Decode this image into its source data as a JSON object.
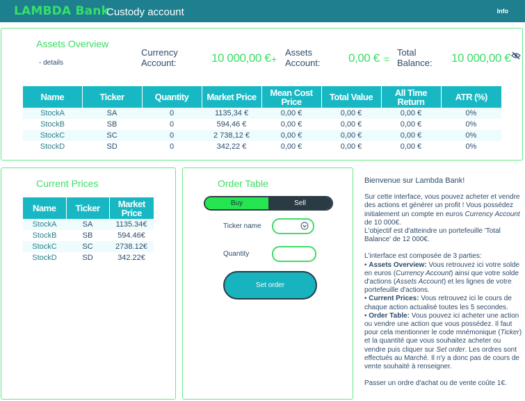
{
  "header": {
    "brand": "LAMBDA Bank",
    "subtitle": "Custody account",
    "info_label": "Info"
  },
  "assets": {
    "title": "Assets Overview",
    "details_label": "- details",
    "currency_label_1": "Currency",
    "currency_label_2": "Account:",
    "currency_value": "10 000,00 €",
    "plus": "+",
    "assets_label_1": "Assets",
    "assets_label_2": "Account:",
    "assets_value": "0,00 €",
    "equals": "=",
    "total_label_1": "Total",
    "total_label_2": "Balance:",
    "total_value": "10 000,00 €",
    "hide_icon": "eye-slash-icon",
    "columns": [
      "Name",
      "Ticker",
      "Quantity",
      "Market Price",
      "Mean Cost Price",
      "Total Value",
      "All Time Return",
      "ATR (%)"
    ],
    "rows": [
      [
        "StockA",
        "SA",
        "0",
        "1135,34 €",
        "0,00 €",
        "0,00 €",
        "0,00 €",
        "0%"
      ],
      [
        "StockB",
        "SB",
        "0",
        "594,46 €",
        "0,00 €",
        "0,00 €",
        "0,00 €",
        "0%"
      ],
      [
        "StockC",
        "SC",
        "0",
        "2 738,12 €",
        "0,00 €",
        "0,00 €",
        "0,00 €",
        "0%"
      ],
      [
        "StockD",
        "SD",
        "0",
        "342,22 €",
        "0,00 €",
        "0,00 €",
        "0,00 €",
        "0%"
      ]
    ]
  },
  "prices": {
    "title": "Current Prices",
    "columns": [
      "Name",
      "Ticker",
      "Market Price"
    ],
    "rows": [
      [
        "StockA",
        "SA",
        "1135.34€"
      ],
      [
        "StockB",
        "SB",
        "594.46€"
      ],
      [
        "StockC",
        "SC",
        "2738.12€"
      ],
      [
        "StockD",
        "SD",
        "342.22€"
      ]
    ]
  },
  "order": {
    "title": "Order Table",
    "buy_label": "Buy",
    "sell_label": "Sell",
    "ticker_label": "Ticker name",
    "ticker_value": "",
    "quantity_label": "Quantity",
    "quantity_value": "",
    "submit_label": "Set order"
  },
  "help": {
    "welcome": "Bienvenue sur Lambda Bank!",
    "p1_a": "Sur cette interface, vous pouvez acheter et vendre des actions et générer un profit ! Vous possédez initialement un compte en euros ",
    "p1_em": "Currency Account",
    "p1_b": " de 10 000€.",
    "p1_c": "L'objectif est d'atteindre un portefeuille 'Total Balance' de 12 000€.",
    "p2_intro": "L'interface est composée de 3 parties:",
    "b1_title": "Assets Overview:",
    "b1_a": " Vous retrouvez ici votre solde en euros (",
    "b1_em1": "Currency Account",
    "b1_b": ") ainsi que votre solde d'actions (",
    "b1_em2": "Assets Account",
    "b1_c": ") et les lignes de votre portefeuille d'actions.",
    "b2_title": "Current Prices:",
    "b2_a": " Vous retrouvez ici le cours de chaque action actualisé toutes les 5 secondes.",
    "b3_title": "Order Table:",
    "b3_a": " Vous pouvez ici acheter une action ou vendre une action que vous possédez. Il faut pour cela mentionner le code mnémonique (",
    "b3_em1": "Ticker",
    "b3_b": ") et la quantité que vous souhaitez acheter ou vendre puis cliquer sur ",
    "b3_em2": "Set order",
    "b3_c": ". Les ordres sont effectués au Marché. Il n'y a donc pas de cours de vente souhaité à renseigner.",
    "fee": "Passer un ordre d'achat ou de vente coûte 1€."
  }
}
